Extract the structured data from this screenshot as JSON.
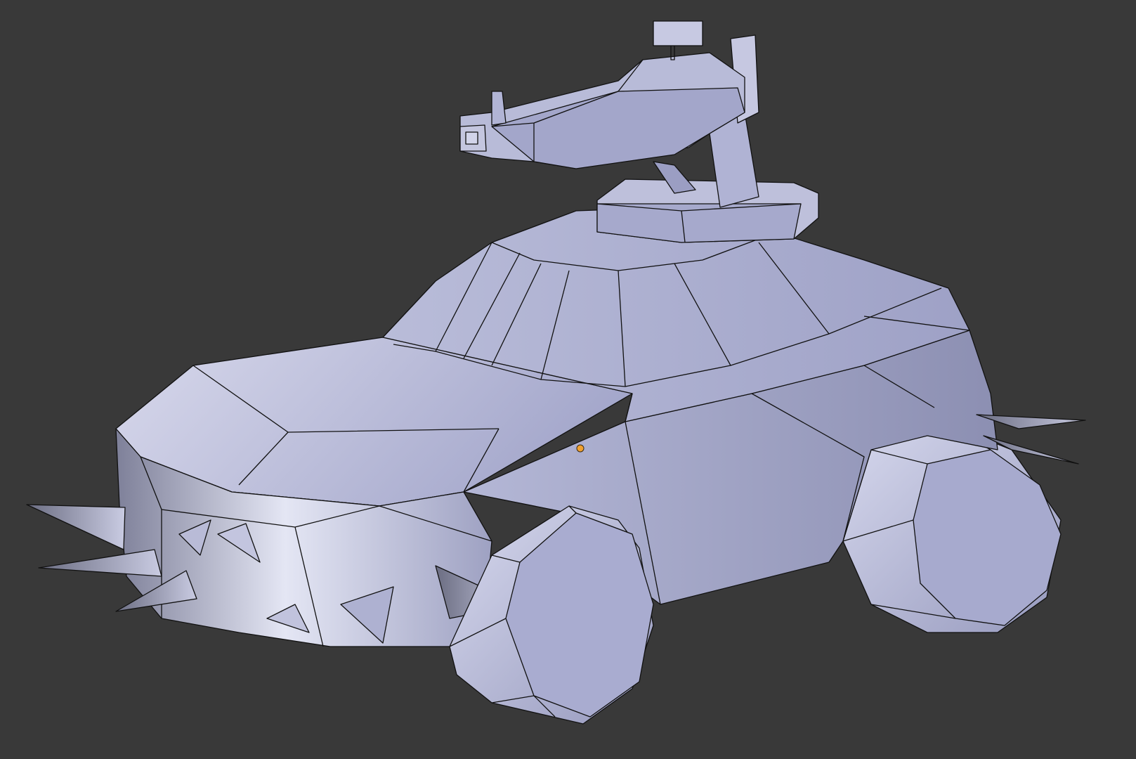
{
  "viewport": {
    "background_color": "#393939",
    "mode": "object",
    "shading": "solid"
  },
  "scene": {
    "object": {
      "kind": "armored car mesh with roof-mounted gun turret",
      "material_color": "#9a9ec4",
      "edge_color": "#000000",
      "origin_marker_color": "#f0a030",
      "selected": false
    }
  }
}
